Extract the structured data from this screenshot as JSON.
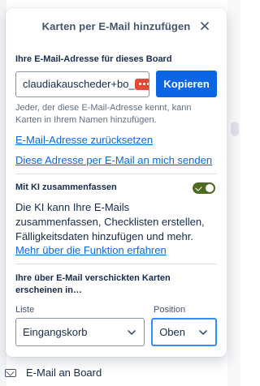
{
  "popover": {
    "title": "Karten per E-Mail hinzufügen",
    "close_icon": "close-icon"
  },
  "email_section": {
    "label": "Ihre E-Mail-Adresse für dieses Board",
    "email_value": "claudiakauscheder+bo_a",
    "copy_label": "Kopieren",
    "help_text": "Jeder, der diese E-Mail-Adresse kennt, kann Karten in Ihrem Namen hinzufügen.",
    "reset_link": "E-Mail-Adresse zurücksetzen",
    "send_link": "Diese Adresse per E-Mail an mich senden"
  },
  "ai_section": {
    "label": "Mit KI zusammenfassen",
    "toggle_on": true,
    "description": "Die KI kann Ihre E-Mails zusammenfassen, Checklisten erstellen, Fälligkeitsdaten hinzufügen und mehr.",
    "learn_more": "Mehr über die Funktion erfahren"
  },
  "destination_section": {
    "label": "Ihre über E-Mail verschickten Karten erscheinen in…",
    "list_label": "Liste",
    "list_value": "Eingangskorb",
    "position_label": "Position",
    "position_value": "Oben"
  },
  "background": {
    "footer_label": "E-Mail an Board"
  },
  "colors": {
    "primary": "#0c66e4",
    "toggle_on": "#4c6b1f",
    "focus_border": "#388bff"
  }
}
